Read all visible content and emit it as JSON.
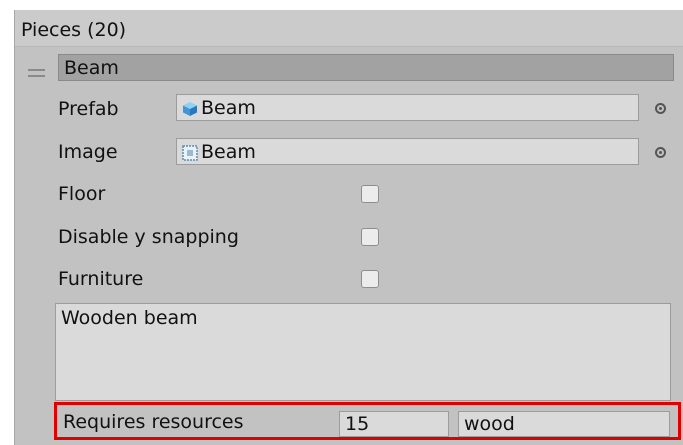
{
  "header": {
    "title": "Pieces (20)"
  },
  "piece": {
    "name": "Beam",
    "prefab": {
      "label": "Prefab",
      "value": "Beam",
      "icon": "cube-icon"
    },
    "image": {
      "label": "Image",
      "value": "Beam",
      "icon": "sprite-icon"
    },
    "floor": {
      "label": "Floor",
      "checked": false
    },
    "disable_y_snapping": {
      "label": "Disable y snapping",
      "checked": false
    },
    "furniture": {
      "label": "Furniture",
      "checked": false
    },
    "description": "Wooden beam",
    "requires_resources": {
      "label": "Requires resources",
      "checked": true,
      "amount": "15",
      "resource": "wood"
    }
  },
  "colors": {
    "highlight": "#e00000",
    "checkmark": "#1a3f8a"
  }
}
